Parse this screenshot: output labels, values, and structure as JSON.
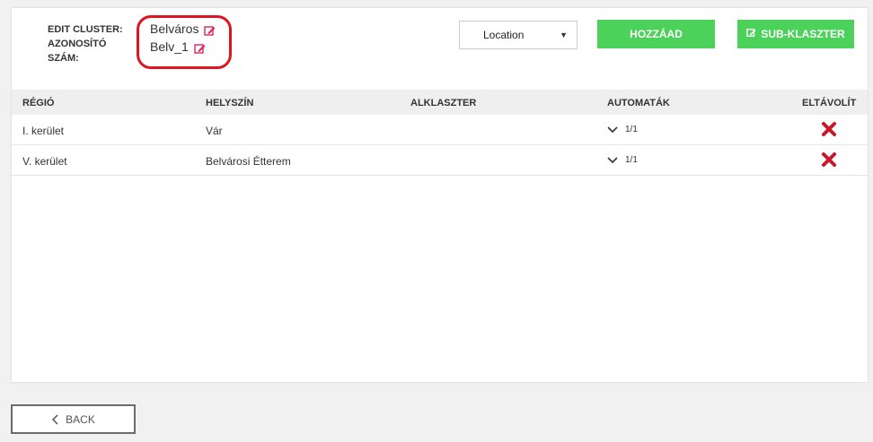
{
  "cluster": {
    "edit_label": "EDIT CLUSTER:",
    "id_label_line1": "AZONOSÍTÓ",
    "id_label_line2": "SZÁM:",
    "name_value": "Belváros",
    "id_value": "Belv_1"
  },
  "toolbar": {
    "location_select": "Location",
    "add_button": "HOZZÁAD",
    "sub_cluster_button": "SUB-KLASZTER"
  },
  "table": {
    "headers": [
      "RÉGIÓ",
      "HELYSZÍN",
      "ALKLASZTER",
      "AUTOMATÁK",
      "ELTÁVOLÍT"
    ],
    "rows": [
      {
        "region": "I. kerület",
        "location": "Vár",
        "subcluster": "",
        "machines": "1/1"
      },
      {
        "region": "V. kerület",
        "location": "Belvárosi Étterem",
        "subcluster": "",
        "machines": "1/1"
      }
    ]
  },
  "footer": {
    "back_button": "BACK"
  },
  "colors": {
    "accent_green": "#4cd15a",
    "remove_red": "#c9182b",
    "highlight_red": "#e0141e",
    "edit_icon": "#e0245e"
  },
  "icons": [
    "edit-icon",
    "chevron-down-icon",
    "remove-x-icon",
    "chevron-left-icon"
  ]
}
